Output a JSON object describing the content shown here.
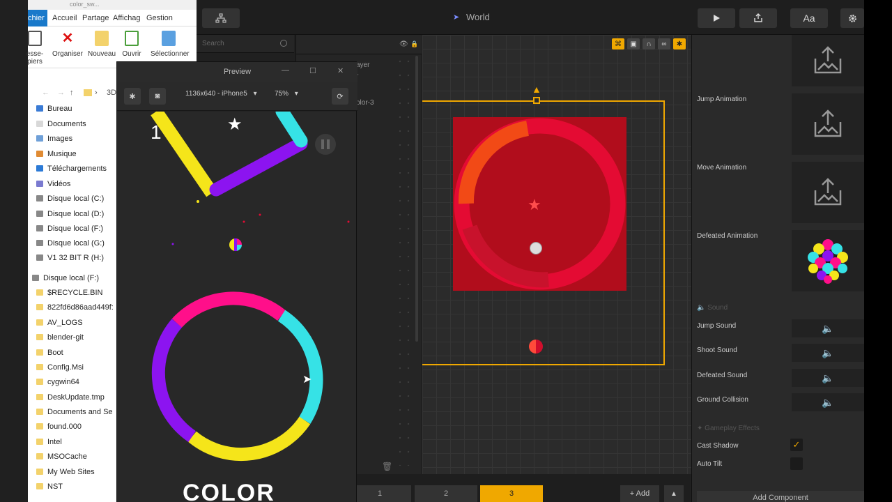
{
  "explorer": {
    "title": "color_sw...",
    "tabs": [
      "chier",
      "Accueil",
      "Partage",
      "Affichag",
      "Gestion"
    ],
    "ribbon": [
      "esse-\npiers",
      "Organiser",
      "Nouveau",
      "Ouvrir",
      "Sélectionner"
    ],
    "address": "3D",
    "nav": [
      "Bureau",
      "Documents",
      "Images",
      "Musique",
      "Téléchargements",
      "Vidéos",
      "Disque local (C:)",
      "Disque local (D:)",
      "Disque local (F:)",
      "Disque local (G:)",
      "V1 32 BIT R (H:)",
      "Disque local (F:)",
      "$RECYCLE.BIN",
      "822fd6d86aad449f:",
      "AV_LOGS",
      "blender-git",
      "Boot",
      "Config.Msi",
      "cygwin64",
      "DeskUpdate.tmp",
      "Documents and Se",
      "found.000",
      "Intel",
      "MSOCache",
      "My Web Sites",
      "NST"
    ]
  },
  "preview": {
    "title": "Preview",
    "device": "1136x640 - iPhone5",
    "zoom": "75%",
    "score": "1",
    "logo": "COLOR"
  },
  "editor": {
    "world_label": "World",
    "search_placeholder": "Search",
    "hierarchy": [
      "ayer",
      "r",
      "olor-3"
    ],
    "text_button": "Aa",
    "pages": [
      "1",
      "2",
      "3"
    ],
    "active_page": "3",
    "add_label": "+ Add"
  },
  "inspector": {
    "jump_animation": "Jump Animation",
    "move_animation": "Move Animation",
    "defeated_animation": "Defeated Animation",
    "sound_section": "Sound",
    "jump_sound": "Jump Sound",
    "shoot_sound": "Shoot Sound",
    "defeated_sound": "Defeated Sound",
    "ground_collision": "Ground Collision",
    "gameplay_section": "Gameplay Effects",
    "cast_shadow": "Cast Shadow",
    "cast_shadow_checked": true,
    "auto_tilt": "Auto Tilt",
    "auto_tilt_checked": false,
    "add_component": "Add Component"
  },
  "colors": {
    "accent": "#f0a800",
    "game_pink": "#ff0f8a",
    "game_cyan": "#36e2e6",
    "game_yellow": "#f5e51a",
    "game_purple": "#8c14f0",
    "scene_red": "#b10d1c"
  }
}
